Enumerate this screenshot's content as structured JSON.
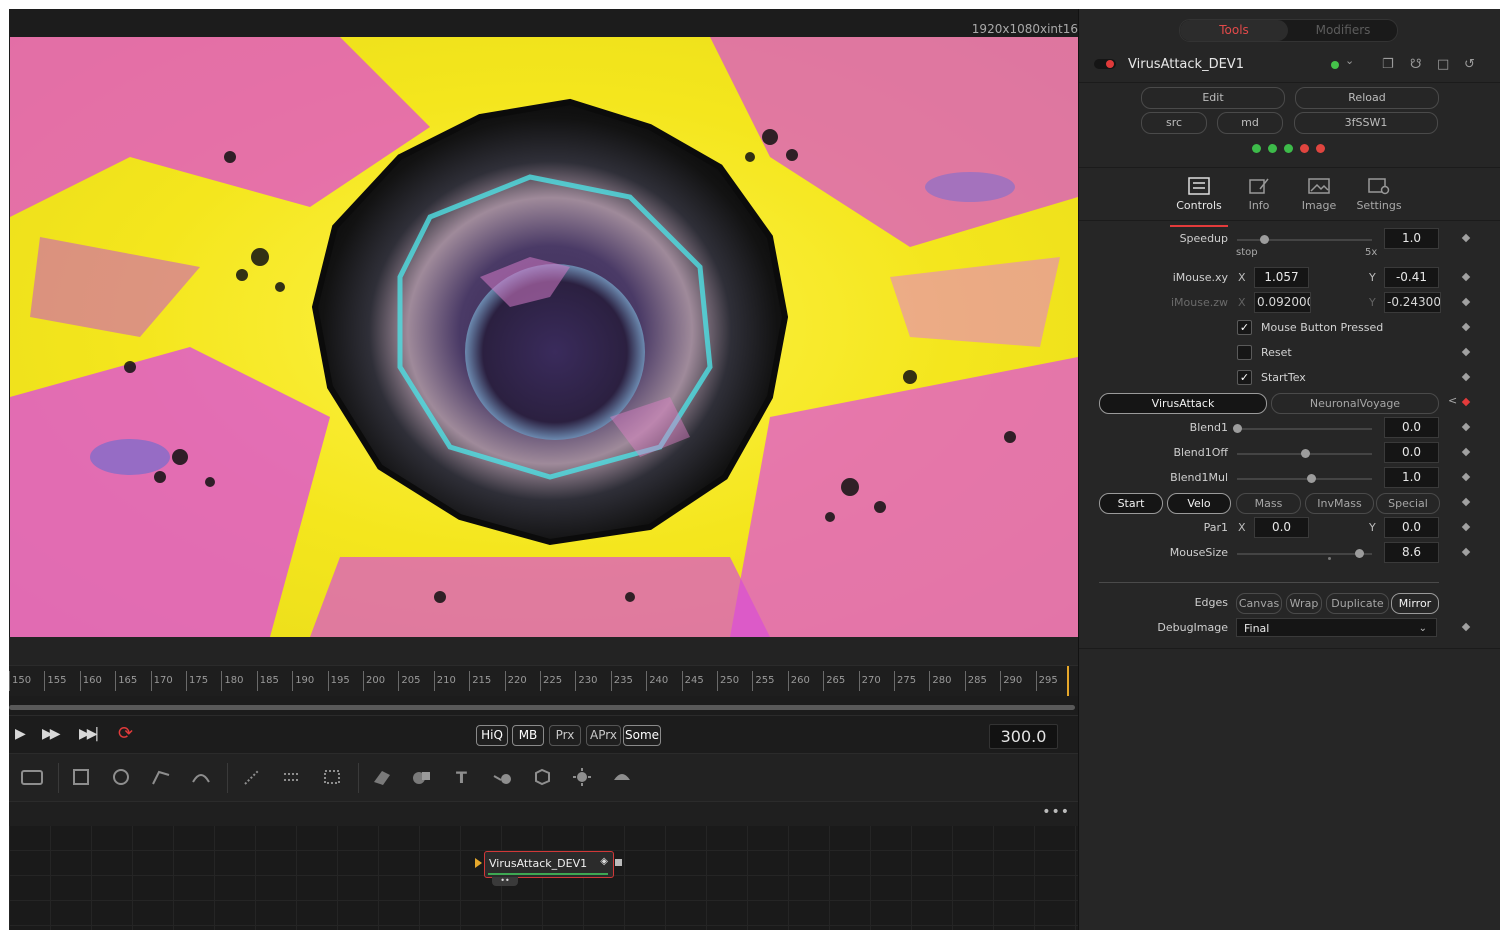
{
  "viewer": {
    "resolution": "1920x1080xint16"
  },
  "timeline": {
    "ticks": [
      "150",
      "155",
      "160",
      "165",
      "170",
      "175",
      "180",
      "185",
      "190",
      "195",
      "200",
      "205",
      "210",
      "215",
      "220",
      "225",
      "230",
      "235",
      "240",
      "245",
      "250",
      "255",
      "260",
      "265",
      "270",
      "275",
      "280",
      "285",
      "290",
      "295"
    ],
    "quality_buttons": [
      {
        "label": "HiQ",
        "on": true
      },
      {
        "label": "MB",
        "on": true
      },
      {
        "label": "Prx",
        "on": false
      },
      {
        "label": "APrx",
        "on": false
      },
      {
        "label": "Some",
        "on": true
      }
    ],
    "current_frame": "300.0"
  },
  "node": {
    "label": "VirusAttack_DEV1"
  },
  "inspector": {
    "tabs": {
      "active": "Tools",
      "inactive": "Modifiers"
    },
    "tool_name": "VirusAttack_DEV1",
    "buttons_row1": [
      "Edit",
      "Reload"
    ],
    "buttons_row2": [
      "src",
      "md",
      "3fSSW1"
    ],
    "status_leds": [
      "#3dbb4a",
      "#3dbb4a",
      "#3dbb4a",
      "#e0453f",
      "#e0453f"
    ],
    "panel_tabs": [
      "Controls",
      "Info",
      "Image",
      "Settings"
    ],
    "speedup": {
      "label": "Speedup",
      "value": "1.0",
      "min_label": "stop",
      "max_label": "5x",
      "level": 0.2
    },
    "imouse_xy": {
      "label": "iMouse.xy",
      "x": "1.057",
      "y": "-0.41"
    },
    "imouse_zw": {
      "label": "iMouse.zw",
      "x": "0.092000",
      "y": "-0.243000"
    },
    "axis": {
      "x": "X",
      "y": "Y"
    },
    "checkboxes": [
      {
        "label": "Mouse Button Pressed",
        "checked": true,
        "mark": "✓"
      },
      {
        "label": "Reset",
        "checked": false,
        "mark": ""
      },
      {
        "label": "StartTex",
        "checked": true,
        "mark": "✓"
      }
    ],
    "blend_mode": {
      "options": [
        "VirusAttack",
        "NeuronalVoyage"
      ],
      "selected": "VirusAttack"
    },
    "sliders": [
      {
        "label": "Blend1",
        "value": "0.0",
        "level": 0.0
      },
      {
        "label": "Blend1Off",
        "value": "0.0",
        "level": 0.5
      },
      {
        "label": "Blend1Mul",
        "value": "1.0",
        "level": 0.55
      }
    ],
    "par_mode": {
      "options": [
        "Start",
        "Velo",
        "Mass",
        "InvMass",
        "Special"
      ],
      "on": [
        "Start",
        "Velo"
      ]
    },
    "par1": {
      "label": "Par1",
      "x": "0.0",
      "y": "0.0"
    },
    "mousesize": {
      "label": "MouseSize",
      "value": "8.6",
      "level": 0.9
    },
    "edges": {
      "label": "Edges",
      "options": [
        "Canvas",
        "Wrap",
        "Duplicate",
        "Mirror"
      ],
      "selected": "Mirror"
    },
    "debugimage": {
      "label": "DebugImage",
      "value": "Final"
    }
  }
}
